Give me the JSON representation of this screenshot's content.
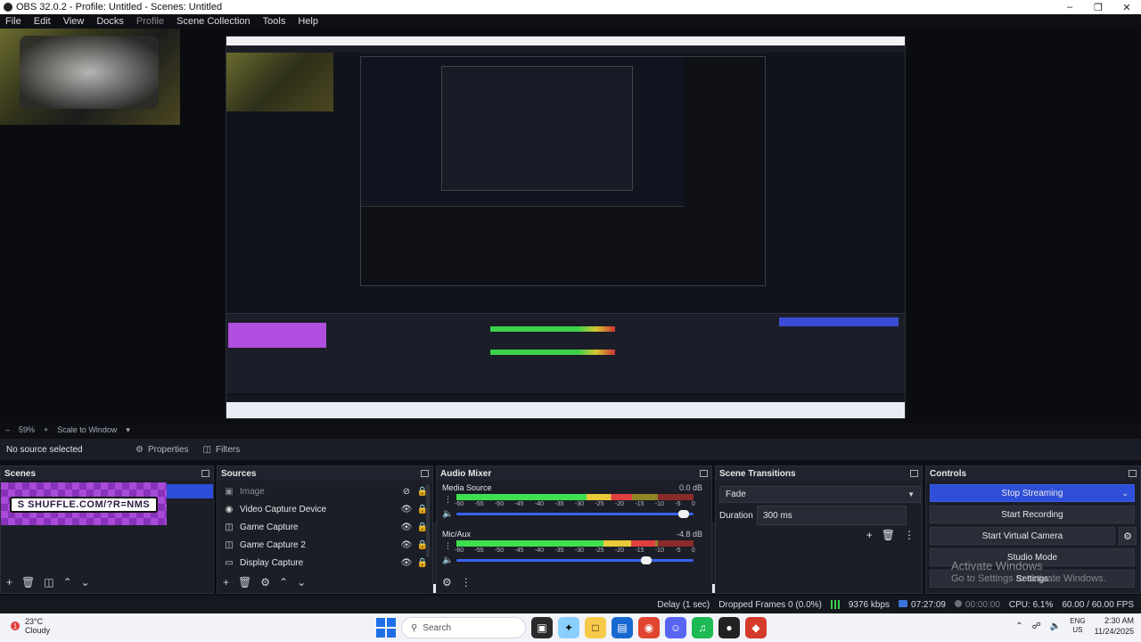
{
  "window": {
    "title": "OBS 32.0.2 - Profile: Untitled - Scenes: Untitled"
  },
  "menu": [
    "File",
    "Edit",
    "View",
    "Docks",
    "Profile",
    "Scene Collection",
    "Tools",
    "Help"
  ],
  "zoom": {
    "percent": "59%",
    "mode": "Scale to Window"
  },
  "source_toolbar": {
    "selection": "No source selected",
    "properties": "Properties",
    "filters": "Filters"
  },
  "scenes": {
    "title": "Scenes",
    "thumbnail_text": "S SHUFFLE.COM/?R=NMS"
  },
  "sources": {
    "title": "Sources",
    "items": [
      {
        "name": "Image",
        "icon": "image-icon",
        "visible": false
      },
      {
        "name": "Video Capture Device",
        "icon": "camera-icon",
        "visible": true
      },
      {
        "name": "Game Capture",
        "icon": "gamepad-icon",
        "visible": true
      },
      {
        "name": "Game Capture 2",
        "icon": "gamepad-icon",
        "visible": true
      },
      {
        "name": "Display Capture",
        "icon": "monitor-icon",
        "visible": true
      }
    ]
  },
  "audio_mixer": {
    "title": "Audio Mixer",
    "channels": [
      {
        "name": "Media Source",
        "db": "0.0 dB",
        "level": 0.74,
        "volume": 0.96
      },
      {
        "name": "Mic/Aux",
        "db": "-4.8 dB",
        "level": 0.84,
        "volume": 0.8
      }
    ],
    "ticks": [
      "-60",
      "-55",
      "-50",
      "-45",
      "-40",
      "-35",
      "-30",
      "-25",
      "-20",
      "-15",
      "-10",
      "-5",
      "0"
    ]
  },
  "scene_transitions": {
    "title": "Scene Transitions",
    "transition": "Fade",
    "duration_label": "Duration",
    "duration_value": "300 ms"
  },
  "controls": {
    "title": "Controls",
    "stop_streaming": "Stop Streaming",
    "start_recording": "Start Recording",
    "start_virtual_camera": "Start Virtual Camera",
    "studio_mode": "Studio Mode",
    "settings": "Settings",
    "watermark_line1": "Activate Windows",
    "watermark_line2": "Go to Settings to activate Windows."
  },
  "status": {
    "delay": "Delay (1 sec)",
    "dropped": "Dropped Frames 0 (0.0%)",
    "bitrate": "9376 kbps",
    "live_time": "07:27:09",
    "rec_time": "00:00:00",
    "cpu": "CPU: 6.1%",
    "fps": "60.00 / 60.00 FPS"
  },
  "taskbar": {
    "weather_temp": "23°C",
    "weather_desc": "Cloudy",
    "weather_badge": "1",
    "search": "Search",
    "lang1": "ENG",
    "lang2": "US",
    "time": "2:30 AM",
    "date": "11/24/2025"
  },
  "colors": {
    "accent": "#2f4fd9",
    "panel": "#1b1e27",
    "background": "#0d0f14",
    "scene_purple": "#a94ad8"
  }
}
